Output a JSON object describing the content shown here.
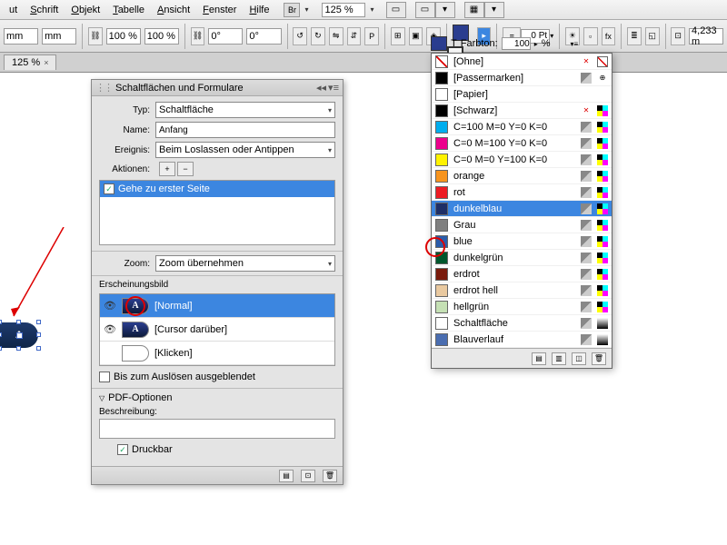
{
  "menu": {
    "items": [
      "ut",
      "Schrift",
      "Objekt",
      "Tabelle",
      "Ansicht",
      "Fenster",
      "Hilfe"
    ],
    "br": "Br",
    "zoom": "125 %"
  },
  "toolbar": {
    "pct1": "100 %",
    "pct2": "100 %",
    "deg1": "0°",
    "deg2": "0°",
    "pt": "0 Pt",
    "farbton_lbl": "Farbton:",
    "farbton": "100",
    "pctlbl": "%",
    "dim": "4,233 m"
  },
  "tabs": {
    "doc": "125 %",
    "x": "×"
  },
  "button_letter": "A",
  "panel": {
    "title": "Schaltflächen und Formulare",
    "typ_lbl": "Typ:",
    "typ": "Schaltfläche",
    "name_lbl": "Name:",
    "name": "Anfang",
    "ereignis_lbl": "Ereignis:",
    "ereignis": "Beim Loslassen oder Antippen",
    "aktionen_lbl": "Aktionen:",
    "action": "Gehe zu erster Seite",
    "zoom_lbl": "Zoom:",
    "zoom": "Zoom übernehmen",
    "erschein": "Erscheinungsbild",
    "states": [
      {
        "label": "[Normal]",
        "sel": true,
        "filled": true
      },
      {
        "label": "[Cursor darüber]",
        "sel": false,
        "filled": true
      },
      {
        "label": "[Klicken]",
        "sel": false,
        "filled": false
      }
    ],
    "hidden": "Bis zum Auslösen ausgeblendet",
    "pdfopt": "PDF-Optionen",
    "beschr": "Beschreibung:",
    "druckbar": "Druckbar"
  },
  "swatches": {
    "farbton_lbl": "Farbton:",
    "farbton": "100",
    "pct": "%",
    "rows": [
      {
        "c": "none",
        "n": "[Ohne]",
        "t": "x"
      },
      {
        "c": "#000",
        "n": "[Passermarken]",
        "t": "reg"
      },
      {
        "c": "#fff",
        "n": "[Papier]",
        "t": ""
      },
      {
        "c": "#000",
        "n": "[Schwarz]",
        "t": "x-cmyk"
      },
      {
        "c": "#00adee",
        "n": "C=100 M=0 Y=0 K=0",
        "t": "cmyk"
      },
      {
        "c": "#ec008c",
        "n": "C=0 M=100 Y=0 K=0",
        "t": "cmyk"
      },
      {
        "c": "#fff200",
        "n": "C=0 M=0 Y=100 K=0",
        "t": "cmyk"
      },
      {
        "c": "#f7941e",
        "n": "orange",
        "t": "cmyk"
      },
      {
        "c": "#ed1c24",
        "n": "rot",
        "t": "cmyk"
      },
      {
        "c": "#1e2f66",
        "n": "dunkelblau",
        "t": "cmyk",
        "sel": true
      },
      {
        "c": "#808080",
        "n": "Grau",
        "t": "cmyk"
      },
      {
        "c": "#2a5caa",
        "n": "blue",
        "t": "cmyk"
      },
      {
        "c": "#00572d",
        "n": "dunkelgrün",
        "t": "cmyk"
      },
      {
        "c": "#7a1b0c",
        "n": "erdrot",
        "t": "cmyk"
      },
      {
        "c": "#e9c9a0",
        "n": "erdrot hell",
        "t": "cmyk"
      },
      {
        "c": "#c5e0b4",
        "n": "hellgrün",
        "t": "cmyk"
      },
      {
        "c": "#fff",
        "n": "Schaltfläche",
        "t": "grad"
      },
      {
        "c": "#4a6db0",
        "n": "Blauverlauf",
        "t": "grad"
      }
    ]
  }
}
